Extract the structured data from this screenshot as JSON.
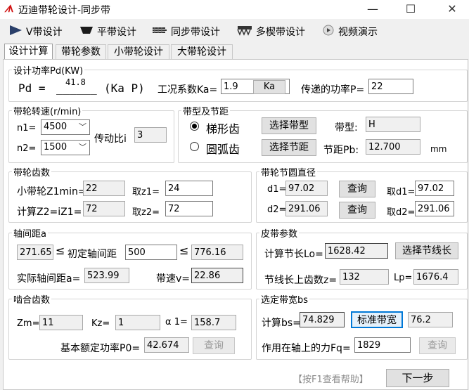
{
  "window": {
    "title": "迈迪带轮设计-同步带",
    "logo": "ᗑ",
    "minimize": "—",
    "maximize": "☐",
    "close": "✕"
  },
  "toolbar": [
    {
      "label": "V带设计",
      "icon": "play-triangle-icon"
    },
    {
      "label": "平带设计",
      "icon": "flat-belt-icon"
    },
    {
      "label": "同步带设计",
      "icon": "timing-belt-icon"
    },
    {
      "label": "多楔带设计",
      "icon": "multi-wedge-belt-icon"
    },
    {
      "label": "视频演示",
      "icon": "video-icon"
    }
  ],
  "tabs": [
    "设计计算",
    "带轮参数",
    "小带轮设计",
    "大带轮设计"
  ],
  "power": {
    "legend": "设计功率Pd(KW)",
    "formula_left": "Pd =",
    "value": "41.8",
    "underscore": "______",
    "formula_right": "(Ka  P)",
    "ka_label": "工况系数Ka=",
    "ka_value": "1.9",
    "ka_button": "Ka",
    "p_label": "传递的功率P=",
    "p_value": "22"
  },
  "speed": {
    "legend": "带轮转速(r/min)",
    "n1_label": "n1=",
    "n1_value": "4500",
    "n2_label": "n2=",
    "n2_value": "1500",
    "ratio_label": "传动比i",
    "ratio_value": "3"
  },
  "belt_type": {
    "legend": "带型及节距",
    "radio1": "梯形齿",
    "radio2": "圆弧齿",
    "btn_type": "选择带型",
    "btn_pitch": "选择节距",
    "type_label": "带型:",
    "type_value": "H",
    "pitch_label": "节距Pb:",
    "pitch_value": "12.700",
    "pitch_unit": "mm"
  },
  "teeth": {
    "legend": "带轮齿数",
    "z1min_label": "小带轮Z1min=",
    "z1min_value": "22",
    "z1_label": "取z1=",
    "z1_value": "24",
    "z2calc_label": "计算Z2=iZ1=",
    "z2calc_value": "72",
    "z2_label": "取z2=",
    "z2_value": "72"
  },
  "pitch_diameter": {
    "legend": "带轮节圆直径",
    "d1_label": "d1=",
    "d1_value": "97.02",
    "d1_btn": "查询",
    "d1_take_label": "取d1=",
    "d1_take_value": "97.02",
    "d2_label": "d2=",
    "d2_value": "291.06",
    "d2_btn": "查询",
    "d2_take_label": "取d2=",
    "d2_take_value": "291.06"
  },
  "center": {
    "legend": "轴间距a",
    "min_value": "271.65",
    "le1": "≤",
    "initial_label": "初定轴间距",
    "initial_value": "500",
    "le2": "≤",
    "max_value": "776.16",
    "actual_label": "实际轴间距a=",
    "actual_value": "523.99",
    "speed_label": "带速v=",
    "speed_value": "22.86"
  },
  "belt_params": {
    "legend": "皮带参数",
    "length_label": "计算节长Lo=",
    "length_value": "1628.42",
    "btn_length": "选择节线长",
    "teeth_label": "节线长上齿数z=",
    "teeth_value": "132",
    "lp_label": "Lp=",
    "lp_value": "1676.4"
  },
  "mesh": {
    "legend": "啮合齿数",
    "zm_label": "Zm=",
    "zm_value": "11",
    "kz_label": "Kz=",
    "kz_value": "1",
    "alpha_label": "α 1=",
    "alpha_value": "158.7",
    "p0_label": "基本额定功率P0=",
    "p0_value": "42.674",
    "p0_btn": "查询"
  },
  "belt_width": {
    "legend": "选定带宽bs",
    "calc_label": "计算bs=",
    "calc_value": "74.829",
    "btn_std": "标准带宽",
    "std_value": "76.2",
    "force_label": "作用在轴上的力Fq=",
    "force_value": "1829",
    "force_btn": "查询"
  },
  "footer": {
    "help": "【按F1查看帮助】",
    "next": "下一步"
  }
}
